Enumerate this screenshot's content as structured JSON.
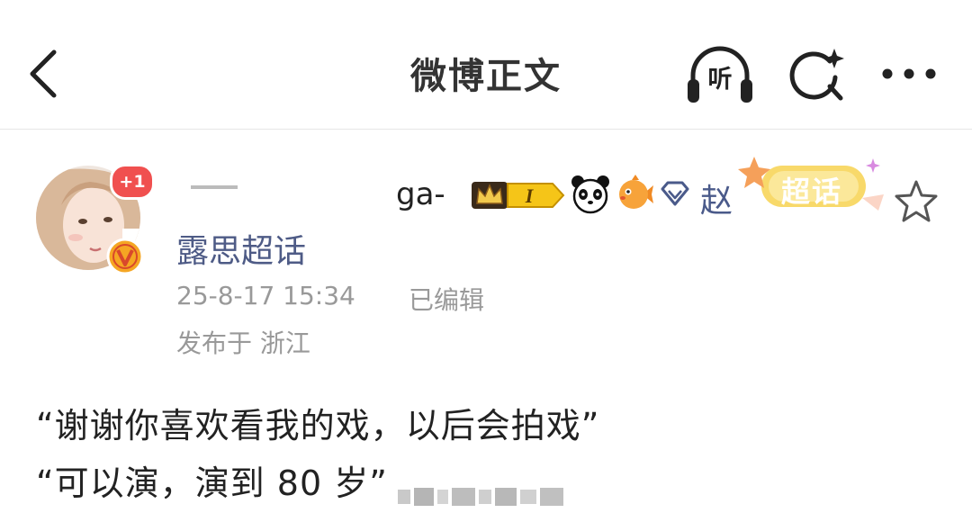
{
  "header": {
    "title": "微博正文",
    "listen_label": "听"
  },
  "post": {
    "avatar_badge": "+1",
    "username_partial": "ga-",
    "user_badge_level": "I",
    "username_suffix": "赵",
    "super_topic_label": "超话",
    "source": "露思超话",
    "timestamp": "25-8-17 15:34",
    "edited_label": "已编辑",
    "location": "发布于 浙江",
    "content_lines": [
      "“谢谢你喜欢看我的戏，以后会拍戏”",
      "“可以演，演到 80 岁”"
    ]
  },
  "colors": {
    "badge_red": "#f0504f",
    "verified_orange": "#f5a623",
    "source_blue": "#4e5b86",
    "meta_gray": "#999999"
  },
  "icons": [
    "back-arrow-icon",
    "headphones-icon",
    "search-sparkle-icon",
    "more-icon",
    "verified-v-icon",
    "crown-icon",
    "panda-icon",
    "fish-icon",
    "diamond-icon",
    "star-icon"
  ]
}
